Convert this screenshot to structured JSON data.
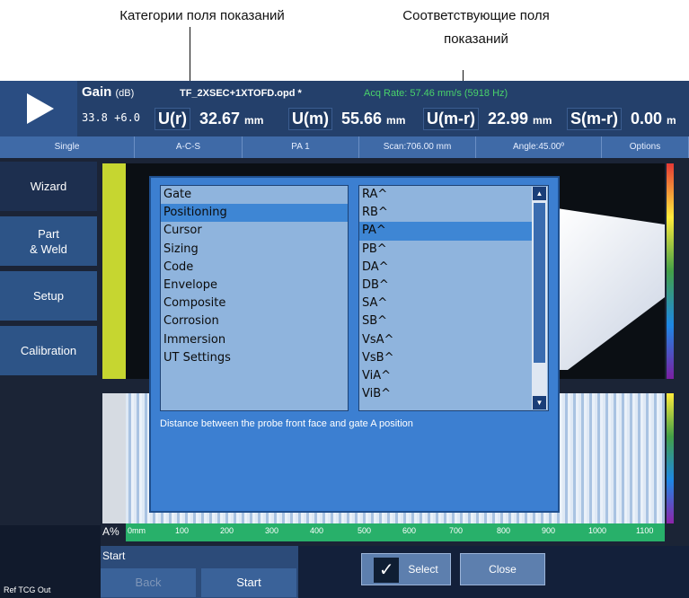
{
  "annotations": {
    "left": "Категории поля показаний",
    "right_line1": "Соответствующие поля",
    "right_line2": "показаний"
  },
  "header": {
    "gain_label": "Gain",
    "gain_unit": "(dB)",
    "gain_value": "33.8 +6.0",
    "file_name": "TF_2XSEC+1XTOFD.opd *",
    "acq_rate": "Acq Rate: 57.46 mm/s (5918 Hz)",
    "readings": [
      {
        "label": "U(r)",
        "value": "32.67",
        "unit": "mm"
      },
      {
        "label": "U(m)",
        "value": "55.66",
        "unit": "mm"
      },
      {
        "label": "U(m-r)",
        "value": "22.99",
        "unit": "mm"
      },
      {
        "label": "S(m-r)",
        "value": "0.00",
        "unit": "m"
      }
    ]
  },
  "tabs": [
    "Single",
    "A-C-S",
    "PA 1",
    "Scan:706.00 mm",
    "Angle:45.00º",
    "Options"
  ],
  "sidebar": {
    "items": [
      {
        "label": "Wizard"
      },
      {
        "label": "Part\n& Weld"
      },
      {
        "label": "Setup"
      },
      {
        "label": "Calibration"
      }
    ]
  },
  "dialog": {
    "categories": [
      "Gate",
      "Positioning",
      "Cursor",
      "Sizing",
      "Code",
      "Envelope",
      "Composite",
      "Corrosion",
      "Immersion",
      "UT Settings"
    ],
    "selected_category": "Positioning",
    "fields": [
      "RA^",
      "RB^",
      "PA^",
      "PB^",
      "DA^",
      "DB^",
      "SA^",
      "SB^",
      "VsA^",
      "VsB^",
      "ViA^",
      "ViB^"
    ],
    "selected_field": "PA^",
    "description": "Distance between the probe front face and gate A position",
    "select_label": "Select",
    "close_label": "Close"
  },
  "bottom": {
    "start_title": "Start",
    "back_label": "Back",
    "start_label": "Start",
    "axis_label": "A%",
    "axis_ticks": [
      "0mm",
      "100",
      "200",
      "300",
      "400",
      "500",
      "600",
      "700",
      "800",
      "900",
      "1000",
      "1100"
    ],
    "status_text": "Ref TCG Out"
  },
  "colors": {
    "dialog_bg": "#3c7fd1",
    "list_bg": "#8fb4dd",
    "selection": "#3e86d4",
    "acq_green": "#49d36a"
  }
}
